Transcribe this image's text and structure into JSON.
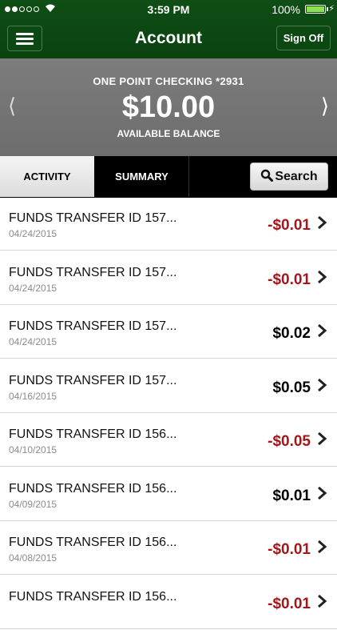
{
  "status_bar": {
    "time": "3:59 PM",
    "battery": "100%",
    "signal_dots": 5,
    "signal_filled": 2
  },
  "nav": {
    "title": "Account",
    "sign_off": "Sign Off",
    "menu_icon": "hamburger-menu-icon"
  },
  "account": {
    "name": "ONE POINT CHECKING *2931",
    "balance": "$10.00",
    "balance_label": "AVAILABLE BALANCE"
  },
  "tabs": {
    "activity": "ACTIVITY",
    "summary": "SUMMARY",
    "search": "Search"
  },
  "transactions": [
    {
      "description": "FUNDS TRANSFER ID 157...",
      "date": "04/24/2015",
      "amount": "-$0.01",
      "negative": true
    },
    {
      "description": "FUNDS TRANSFER ID 157...",
      "date": "04/24/2015",
      "amount": "-$0.01",
      "negative": true
    },
    {
      "description": "FUNDS TRANSFER ID 157...",
      "date": "04/24/2015",
      "amount": "$0.02",
      "negative": false
    },
    {
      "description": "FUNDS TRANSFER ID 157...",
      "date": "04/16/2015",
      "amount": "$0.05",
      "negative": false
    },
    {
      "description": "FUNDS TRANSFER ID 156...",
      "date": "04/10/2015",
      "amount": "-$0.05",
      "negative": true
    },
    {
      "description": "FUNDS TRANSFER ID 156...",
      "date": "04/09/2015",
      "amount": "$0.01",
      "negative": false
    },
    {
      "description": "FUNDS TRANSFER ID 156...",
      "date": "04/08/2015",
      "amount": "-$0.01",
      "negative": true
    },
    {
      "description": "FUNDS TRANSFER ID 156...",
      "date": "",
      "amount": "-$0.01",
      "negative": true
    }
  ],
  "colors": {
    "brand_green": "#0f4e15",
    "negative_amount": "#a4161a",
    "account_panel": "#767676"
  }
}
